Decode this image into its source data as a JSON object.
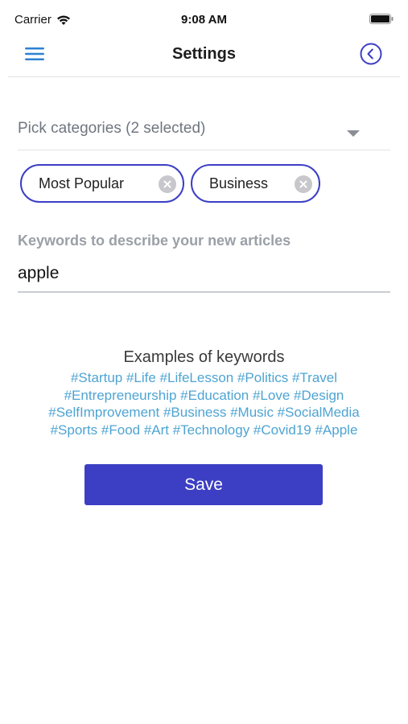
{
  "status_bar": {
    "carrier": "Carrier",
    "time": "9:08 AM"
  },
  "header": {
    "title": "Settings"
  },
  "categories": {
    "picker_label": "Pick categories (2 selected)",
    "chips": [
      {
        "label": "Most Popular"
      },
      {
        "label": "Business"
      }
    ]
  },
  "keywords": {
    "label": "Keywords to describe your new articles",
    "value": "apple"
  },
  "examples": {
    "title": "Examples of keywords",
    "lines": [
      "#Startup #Life #LifeLesson #Politics #Travel",
      "#Entrepreneurship #Education #Love #Design",
      "#SelfImprovement #Business #Music #SocialMedia",
      "#Sports #Food #Art #Technology #Covid19 #Apple"
    ]
  },
  "save_button": {
    "label": "Save"
  },
  "colors": {
    "accent": "#3c3fc4",
    "link": "#4ea4d3",
    "menu": "#2f80d1"
  },
  "icons": [
    "wifi-icon",
    "battery-icon",
    "hamburger-menu-icon",
    "back-circle-icon",
    "chevron-down-icon",
    "clear-chip-icon"
  ]
}
